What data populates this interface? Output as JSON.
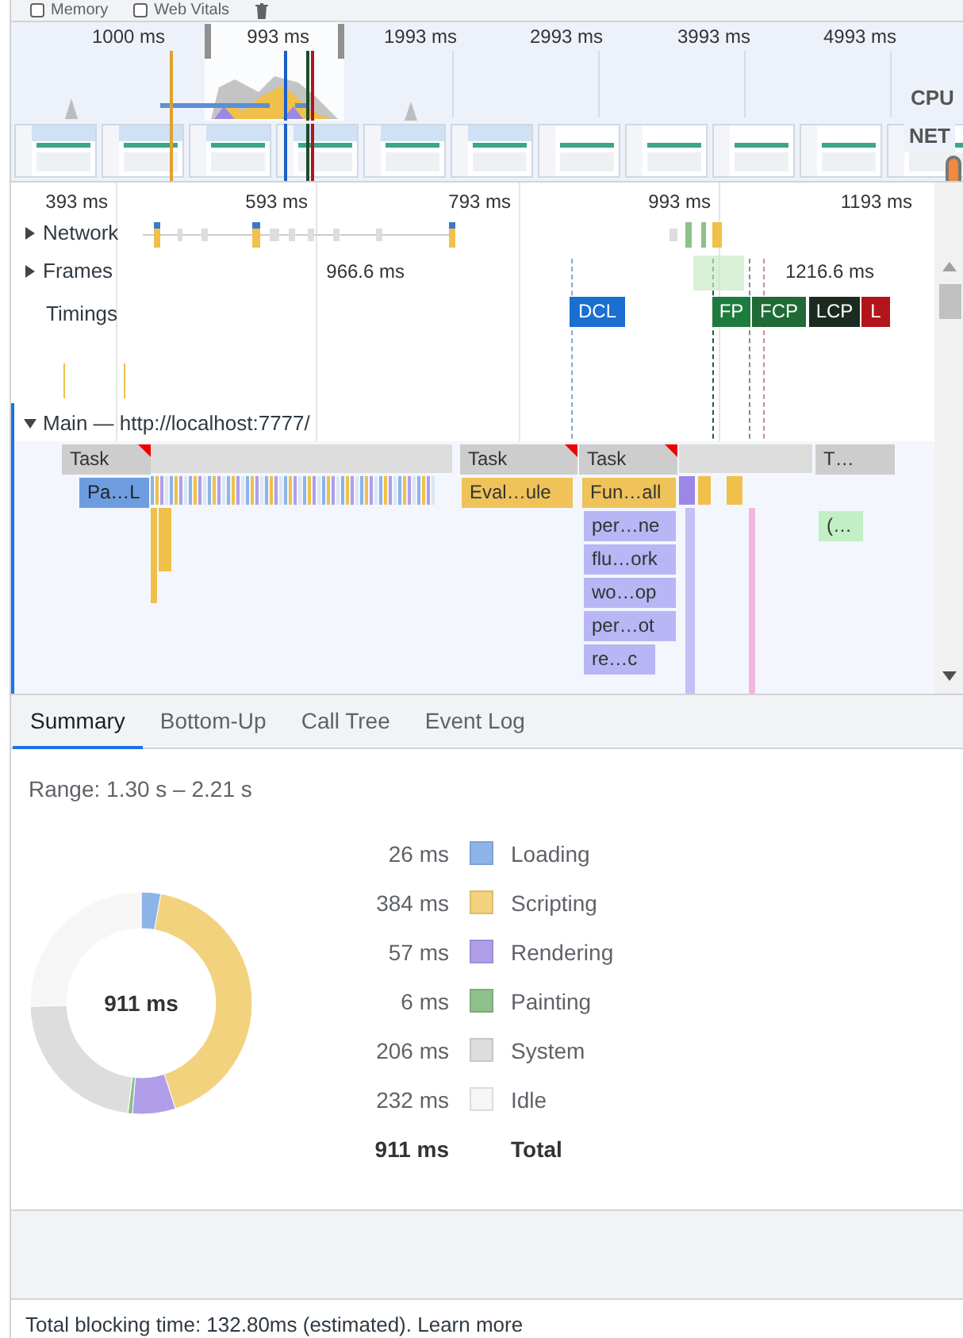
{
  "toolbar": {
    "checkboxes": [
      {
        "label": "Memory",
        "checked": false
      },
      {
        "label": "Web Vitals",
        "checked": false
      }
    ]
  },
  "overview": {
    "ticks": [
      "1000 ms",
      "993 ms",
      "1993 ms",
      "2993 ms",
      "3993 ms",
      "4993 ms"
    ],
    "cpu_label": "CPU",
    "net_label": "NET"
  },
  "timeline": {
    "ticks": [
      "393 ms",
      "593 ms",
      "793 ms",
      "993 ms",
      "1193 ms"
    ],
    "tracks": [
      {
        "label": "Network",
        "expanded": false
      },
      {
        "label": "Frames",
        "expanded": false
      }
    ],
    "frame_times": [
      "966.6 ms",
      "1216.6 ms"
    ],
    "timings_label": "Timings",
    "markers": [
      {
        "label": "DCL",
        "color": "#1a6fd1"
      },
      {
        "label": "FP",
        "color": "#1e7b3e"
      },
      {
        "label": "FCP",
        "color": "#1f6a35"
      },
      {
        "label": "LCP",
        "color": "#1c2b1f"
      },
      {
        "label": "L",
        "color": "#b3141b"
      }
    ],
    "main": {
      "label": "Main — http://localhost:7777/",
      "expanded": true,
      "blocks": [
        {
          "label": "Task",
          "kind": "task"
        },
        {
          "label": "Task",
          "kind": "task"
        },
        {
          "label": "Task",
          "kind": "task"
        },
        {
          "label": "T…",
          "kind": "task"
        },
        {
          "label": "Pa…L",
          "kind": "loading"
        },
        {
          "label": "Eval…ule",
          "kind": "scripting"
        },
        {
          "label": "Fun…all",
          "kind": "scripting"
        },
        {
          "label": "per…ne",
          "kind": "rendering"
        },
        {
          "label": "(…",
          "kind": "painting"
        },
        {
          "label": "flu…ork",
          "kind": "rendering"
        },
        {
          "label": "wo…op",
          "kind": "rendering"
        },
        {
          "label": "per…ot",
          "kind": "rendering"
        },
        {
          "label": "re…c",
          "kind": "rendering"
        }
      ]
    }
  },
  "tabs": [
    {
      "label": "Summary",
      "selected": true
    },
    {
      "label": "Bottom-Up",
      "selected": false
    },
    {
      "label": "Call Tree",
      "selected": false
    },
    {
      "label": "Event Log",
      "selected": false
    }
  ],
  "summary": {
    "range": "Range: 1.30 s – 2.21 s",
    "center_label": "911 ms",
    "legend": [
      {
        "value": "26 ms",
        "label": "Loading",
        "color": "#8db4e8"
      },
      {
        "value": "384 ms",
        "label": "Scripting",
        "color": "#f3d27e"
      },
      {
        "value": "57 ms",
        "label": "Rendering",
        "color": "#b09ee9"
      },
      {
        "value": "6 ms",
        "label": "Painting",
        "color": "#8dc08a"
      },
      {
        "value": "206 ms",
        "label": "System",
        "color": "#dddddd"
      },
      {
        "value": "232 ms",
        "label": "Idle",
        "color": "#f6f6f6"
      }
    ],
    "total": {
      "value": "911 ms",
      "label": "Total"
    }
  },
  "footer": {
    "text": "Total blocking time: 132.80ms (estimated).",
    "link": "Learn more"
  }
}
